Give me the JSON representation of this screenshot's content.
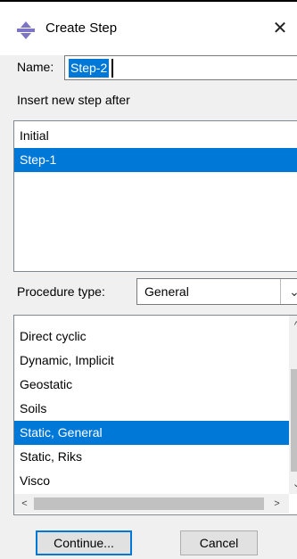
{
  "window": {
    "title": "Create Step",
    "close_glyph": "✕"
  },
  "name": {
    "label": "Name:",
    "value": "Step-2"
  },
  "insert": {
    "label": "Insert new step after",
    "items": [
      {
        "label": "Initial",
        "selected": false
      },
      {
        "label": "Step-1",
        "selected": true
      }
    ]
  },
  "procedure": {
    "label": "Procedure type:",
    "selected": "General",
    "dropdown_glyph": "⌄",
    "options": [
      {
        "label": "Direct cyclic",
        "selected": false
      },
      {
        "label": "Dynamic, Implicit",
        "selected": false
      },
      {
        "label": "Geostatic",
        "selected": false
      },
      {
        "label": "Soils",
        "selected": false
      },
      {
        "label": "Static, General",
        "selected": true
      },
      {
        "label": "Static, Riks",
        "selected": false
      },
      {
        "label": "Visco",
        "selected": false
      }
    ]
  },
  "scroll": {
    "up": "^",
    "down": "⌄",
    "left": "<",
    "right": ">"
  },
  "buttons": {
    "continue": "Continue...",
    "cancel": "Cancel"
  },
  "colors": {
    "selection": "#0078d7",
    "icon": "#7c74c4"
  }
}
